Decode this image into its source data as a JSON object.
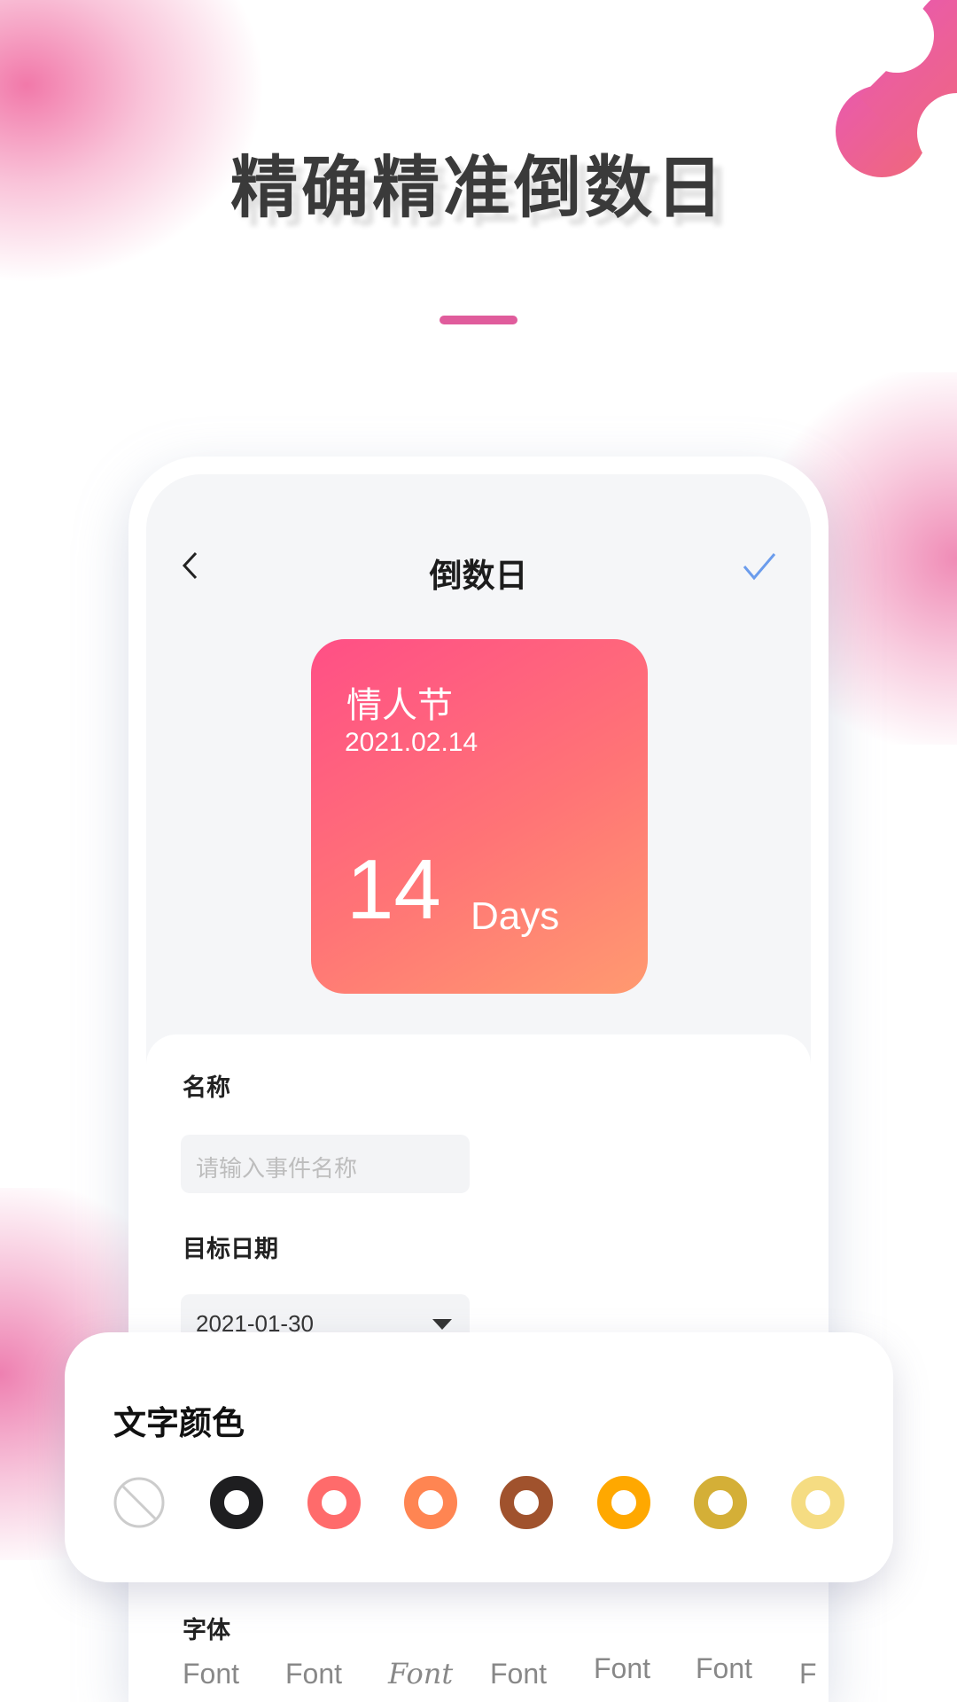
{
  "hero": {
    "title": "精确精准倒数日"
  },
  "screen": {
    "header": {
      "title": "倒数日",
      "back_icon": "chevron-left-icon",
      "confirm_icon": "check-icon",
      "confirm_color": "#6b9cec"
    },
    "card": {
      "name": "情人节",
      "date": "2021.02.14",
      "days": "14",
      "unit": "Days"
    },
    "form": {
      "name_label": "名称",
      "name_placeholder": "请输入事件名称",
      "date_label": "目标日期",
      "date_value": "2021-01-30",
      "font_label": "字体",
      "font_options": [
        "Font",
        "Font",
        "Font",
        "Font",
        "Font",
        "Font",
        "F"
      ]
    }
  },
  "color_popup": {
    "title": "文字颜色",
    "colors": [
      "none",
      "#1e1e20",
      "#ff6b6b",
      "#ff8552",
      "#a0522d",
      "#ffa800",
      "#d4af37",
      "#f5dc82"
    ]
  }
}
